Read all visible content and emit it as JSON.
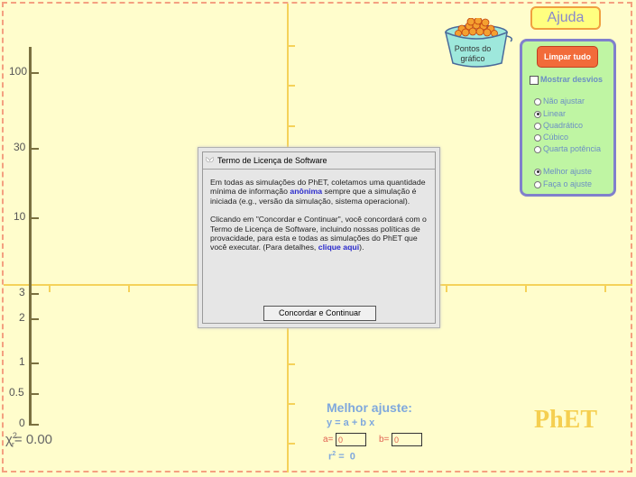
{
  "help": {
    "label": "Ajuda"
  },
  "bucket": {
    "label": "Pontos do gráfico"
  },
  "control_panel": {
    "reset_label": "Limpar tudo",
    "show_residuals_label": "Mostrar desvios",
    "show_residuals_checked": false,
    "fit_types": [
      {
        "label": "Não ajustar",
        "selected": false
      },
      {
        "label": "Linear",
        "selected": true
      },
      {
        "label": "Quadrático",
        "selected": false
      },
      {
        "label": "Cúbico",
        "selected": false
      },
      {
        "label": "Quarta potência",
        "selected": false
      }
    ],
    "fit_modes": [
      {
        "label": "Melhor ajuste",
        "selected": true
      },
      {
        "label": "Faça o ajuste",
        "selected": false
      }
    ]
  },
  "chi_square": {
    "tick_labels": [
      "100",
      "30",
      "10",
      "3",
      "2",
      "1",
      "0.5",
      "0"
    ],
    "symbol": "χ",
    "sub": "r",
    "sup": "2",
    "value_text": "= 0.00"
  },
  "dialog": {
    "title": "Termo de Licença de Software",
    "p1_a": "Em todas as simulações do PhET, coletamos uma quantidade mínima de informação",
    "p1_link": "anônima",
    "p1_b": "sempre que a simulação é iniciada (e.g., versão da simulação, sistema operacional).",
    "p2_a": "Clicando em \"Concordar e Continuar\", você concordará com o Termo de Licença de Software, incluindo nossas políticas de provacidade, para esta e todas as simulações do PhET que você executar. (Para detalhes,",
    "p2_link": "clique aqui",
    "p2_b": ").",
    "button_label": "Concordar e Continuar"
  },
  "fit_info": {
    "title": "Melhor ajuste:",
    "equation": "y = a + b x",
    "a_label": "a=",
    "a_value": "0",
    "b_label": "b=",
    "b_value": "0",
    "r2_prefix": "r",
    "r2_sup": "2",
    "r2_value": " =  0"
  },
  "logo": {
    "text": "PhET"
  },
  "colors": {
    "background": "#fffdcc",
    "axis": "#f5d25a",
    "border_dashed": "#f4a080",
    "panel": "#bff5a3",
    "panel_border": "#8080cc",
    "reset_button": "#f26b3a",
    "fit_text": "#7fa8dd",
    "coef_text": "#e06050"
  }
}
